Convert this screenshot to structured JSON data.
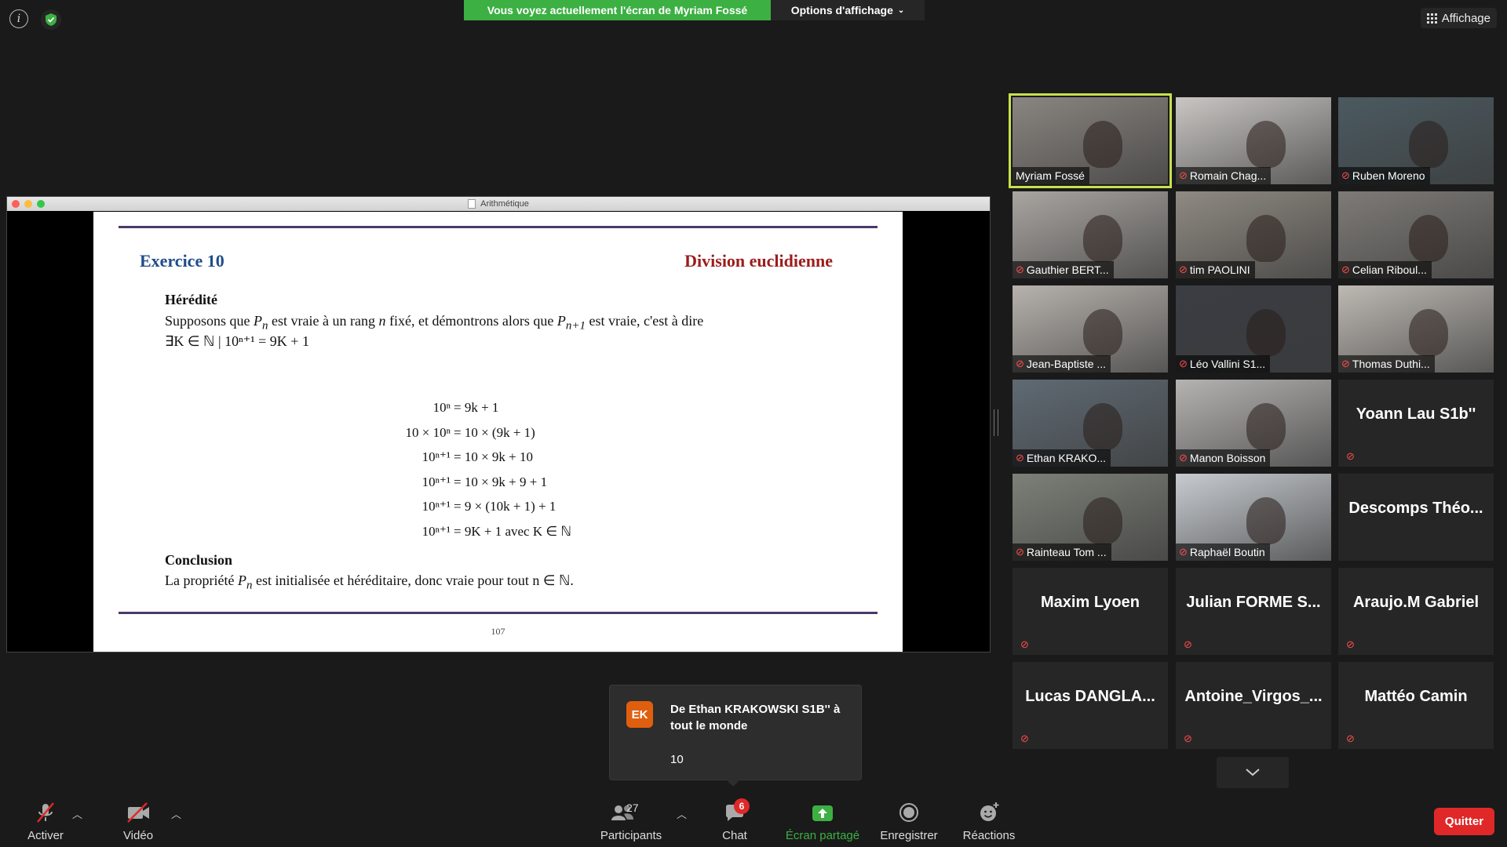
{
  "top_bar": {
    "viewing_banner": "Vous voyez actuellement l'écran de Myriam Fossé",
    "view_options": "Options d'affichage",
    "layout_button": "Affichage"
  },
  "doc": {
    "window_title": "Arithmétique",
    "exercise_title": "Exercice 10",
    "topic": "Division euclidienne",
    "heredite_heading": "Hérédité",
    "heredite_line1_a": "Supposons que ",
    "heredite_line1_b": " est vraie à un rang ",
    "heredite_line1_c": " fixé, et démontrons alors que ",
    "heredite_line1_d": " est vraie, c'est à dire",
    "heredite_line2": "∃K ∈ ℕ | 10ⁿ⁺¹ = 9K + 1",
    "equations": [
      {
        "lhs": "10ⁿ",
        "rhs": "= 9k + 1"
      },
      {
        "lhs": "10 × 10ⁿ",
        "rhs": "= 10 × (9k + 1)"
      },
      {
        "lhs": "10ⁿ⁺¹",
        "rhs": "= 10 × 9k + 10"
      },
      {
        "lhs": "10ⁿ⁺¹",
        "rhs": "= 10 × 9k + 9 + 1"
      },
      {
        "lhs": "10ⁿ⁺¹",
        "rhs": "= 9 × (10k + 1) + 1"
      },
      {
        "lhs": "10ⁿ⁺¹",
        "rhs": "= 9K + 1 avec K ∈ ℕ"
      }
    ],
    "conclusion_heading": "Conclusion",
    "conclusion_a": "La propriété ",
    "conclusion_b": " est initialisée et héréditaire, donc vraie pour tout ",
    "conclusion_c": "n ∈ ℕ.",
    "page_number": "107"
  },
  "participants": [
    {
      "name": "Myriam Fossé",
      "video": true,
      "muted": false,
      "active": true,
      "bg": "#8a8580"
    },
    {
      "name": "Romain Chag...",
      "video": true,
      "muted": true,
      "bg": "#c9c6c3"
    },
    {
      "name": "Ruben Moreno",
      "video": true,
      "muted": true,
      "bg": "#4b5a60"
    },
    {
      "name": "Gauthier BERT...",
      "video": true,
      "muted": true,
      "bg": "#a9a5a1"
    },
    {
      "name": "tim PAOLINI",
      "video": true,
      "muted": true,
      "bg": "#8f8a82"
    },
    {
      "name": "Celian Riboul...",
      "video": true,
      "muted": true,
      "bg": "#7e7b77"
    },
    {
      "name": "Jean-Baptiste ...",
      "video": true,
      "muted": true,
      "bg": "#b7b2ad"
    },
    {
      "name": "Léo Vallini S1...",
      "video": true,
      "muted": true,
      "bg": "#3b3d44"
    },
    {
      "name": "Thomas Duthi...",
      "video": true,
      "muted": true,
      "bg": "#bdb9b3"
    },
    {
      "name": "Ethan KRAKO...",
      "video": true,
      "muted": true,
      "bg": "#5f6a73"
    },
    {
      "name": "Manon Boisson",
      "video": true,
      "muted": true,
      "bg": "#b5b3b2"
    },
    {
      "name": "Yoann Lau S1b''",
      "video": false,
      "muted": true
    },
    {
      "name": "Rainteau Tom ...",
      "video": true,
      "muted": true,
      "bg": "#7d8078"
    },
    {
      "name": "Raphaël Boutin",
      "video": true,
      "muted": true,
      "bg": "#c7cbd0"
    },
    {
      "name": "Descomps  Théo...",
      "video": false,
      "muted": false
    },
    {
      "name": "Maxim Lyoen",
      "video": false,
      "muted": true
    },
    {
      "name": "Julian  FORME  S...",
      "video": false,
      "muted": true
    },
    {
      "name": "Araujo.M Gabriel",
      "video": false,
      "muted": true
    },
    {
      "name": "Lucas  DANGLA...",
      "video": false,
      "muted": true
    },
    {
      "name": "Antoine_Virgos_...",
      "video": false,
      "muted": true
    },
    {
      "name": "Mattéo Camin",
      "video": false,
      "muted": true
    }
  ],
  "chat_toast": {
    "avatar": "EK",
    "from": "De Ethan KRAKOWSKI S1B'' à tout le monde",
    "message": "10"
  },
  "toolbar": {
    "unmute": "Activer",
    "video": "Vidéo",
    "participants": "Participants",
    "participant_count": "27",
    "chat": "Chat",
    "chat_badge": "6",
    "share": "Écran partagé",
    "record": "Enregistrer",
    "reactions": "Réactions",
    "leave": "Quitter"
  }
}
